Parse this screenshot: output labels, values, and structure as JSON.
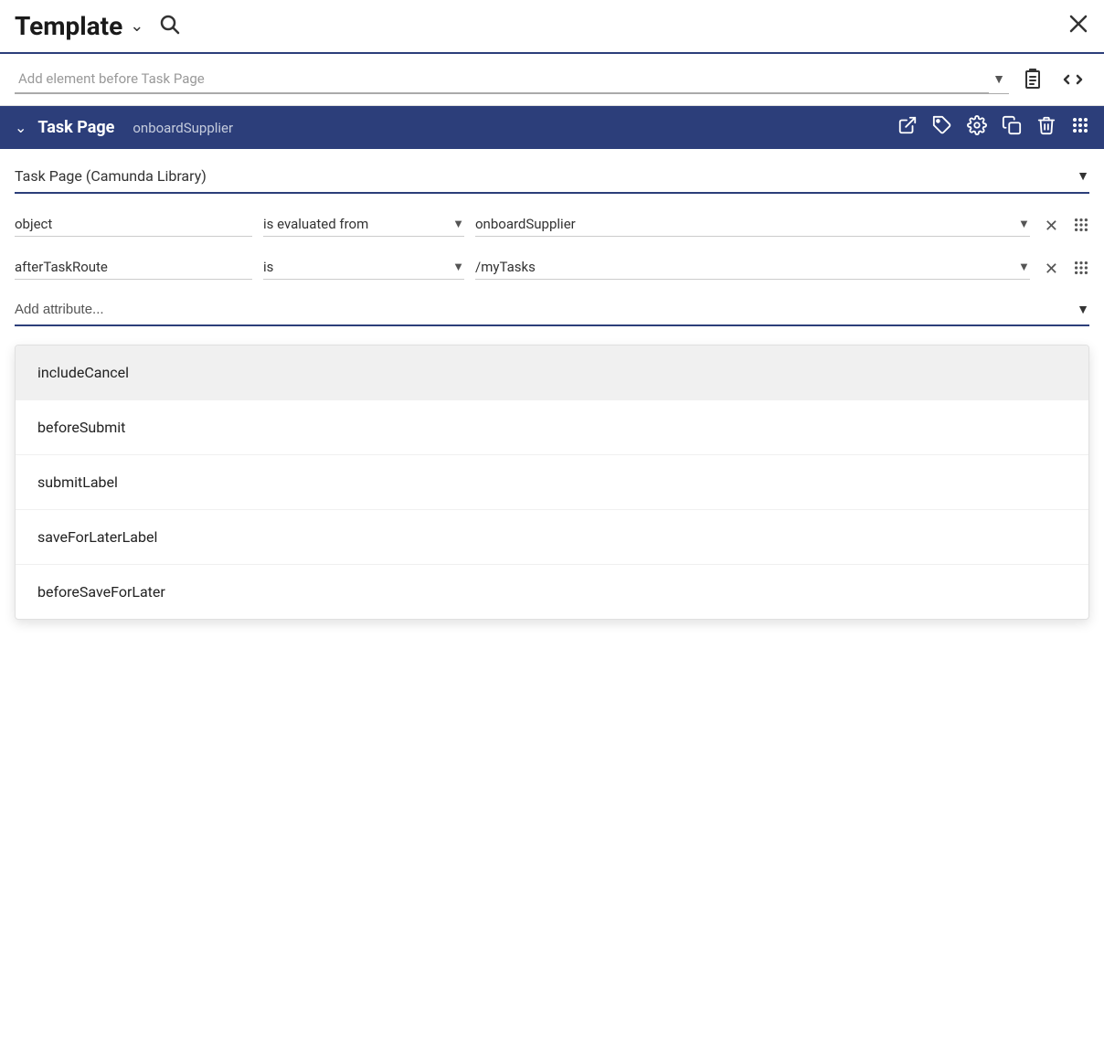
{
  "header": {
    "title": "Template",
    "chevron": "˅",
    "search_icon": "🔍",
    "close_icon": "✕"
  },
  "toolbar": {
    "add_element_placeholder": "Add element before Task Page",
    "clipboard_icon": "clipboard",
    "code_icon": "<>"
  },
  "task_page_bar": {
    "chevron": "˅",
    "title": "Task Page",
    "subtitle": "onboardSupplier",
    "icons": [
      "external-link",
      "tag",
      "gear",
      "copy",
      "trash",
      "dots"
    ]
  },
  "library_dropdown": {
    "label": "Task Page (Camunda Library)"
  },
  "attributes": [
    {
      "name": "object",
      "operator": "is evaluated from",
      "value": "onboardSupplier"
    },
    {
      "name": "afterTaskRoute",
      "operator": "is",
      "value": "/myTasks"
    }
  ],
  "add_attribute": {
    "placeholder": "Add attribute..."
  },
  "dropdown_options": [
    "includeCancel",
    "beforeSubmit",
    "submitLabel",
    "saveForLaterLabel",
    "beforeSaveForLater"
  ],
  "colors": {
    "nav_bar": "#2c3e7a",
    "accent_blue": "#2c3e7a",
    "text_dark": "#1a1a1a",
    "text_medium": "#333",
    "text_light": "#999"
  }
}
